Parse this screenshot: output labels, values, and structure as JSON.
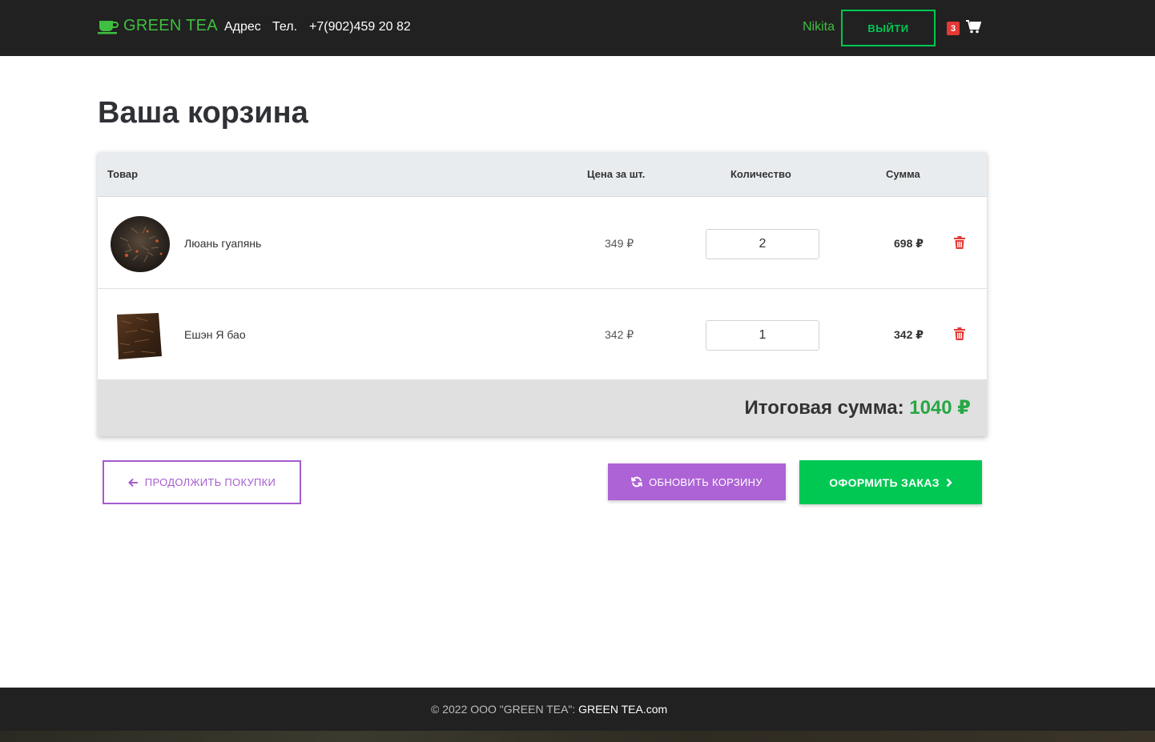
{
  "header": {
    "brand": "GREEN TEA",
    "address_label": "Адрес",
    "phone_label": "Тел.",
    "phone": "+7(902)459 20 82",
    "username": "Nikita",
    "logout_label": "ВЫЙТИ",
    "cart_count": "3"
  },
  "page": {
    "title": "Ваша корзина"
  },
  "table": {
    "headers": {
      "product": "Товар",
      "unit_price": "Цена за шт.",
      "quantity": "Количество",
      "sum": "Сумма"
    },
    "rows": [
      {
        "name": "Люань гуапянь",
        "price": "349 ₽",
        "quantity": "2",
        "sum": "698 ₽"
      },
      {
        "name": "Ешэн Я бао",
        "price": "342 ₽",
        "quantity": "1",
        "sum": "342 ₽"
      }
    ],
    "total_label": "Итоговая сумма:",
    "total_amount": "1040 ₽"
  },
  "actions": {
    "continue_label": "ПРОДОЛЖИТЬ ПОКУПКИ",
    "update_label": "ОБНОВИТЬ КОРЗИНУ",
    "checkout_label": "ОФОРМИТЬ ЗАКАЗ"
  },
  "footer": {
    "copyright": "© 2022 ООО \"GREEN TEA\": ",
    "link": "GREEN TEA.com"
  },
  "colors": {
    "brand_green": "#3fbf3f",
    "accent_green": "#00c853",
    "purple": "#ad63d6",
    "danger": "#e53935",
    "dark": "#212121"
  }
}
